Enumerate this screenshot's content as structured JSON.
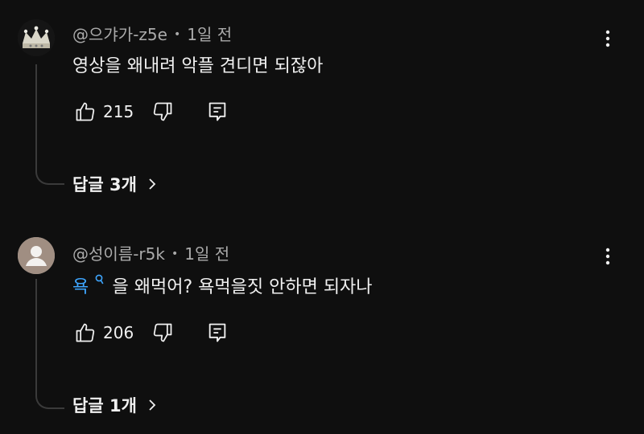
{
  "comments": [
    {
      "author": "@으갸가-z5e",
      "time": "1일 전",
      "text": "영상을 왜내려 악플 견디면 되잖아",
      "likes": "215",
      "replies_label": "답글 3개",
      "avatar_icon": "crown-avatar"
    },
    {
      "author": "@성이름-r5k",
      "time": "1일 전",
      "text_link": "욕",
      "text_link_icon": "search-icon",
      "text_rest": "을 왜먹어? 욕먹을짓 안하면 되자나",
      "likes": "206",
      "replies_label": "답글 1개",
      "avatar_icon": "default-person-avatar"
    }
  ],
  "separator": "•",
  "colors": {
    "background": "#0f0f0f",
    "text": "#f1f1f1",
    "secondary": "#aaaaaa",
    "link": "#3ea6ff"
  }
}
